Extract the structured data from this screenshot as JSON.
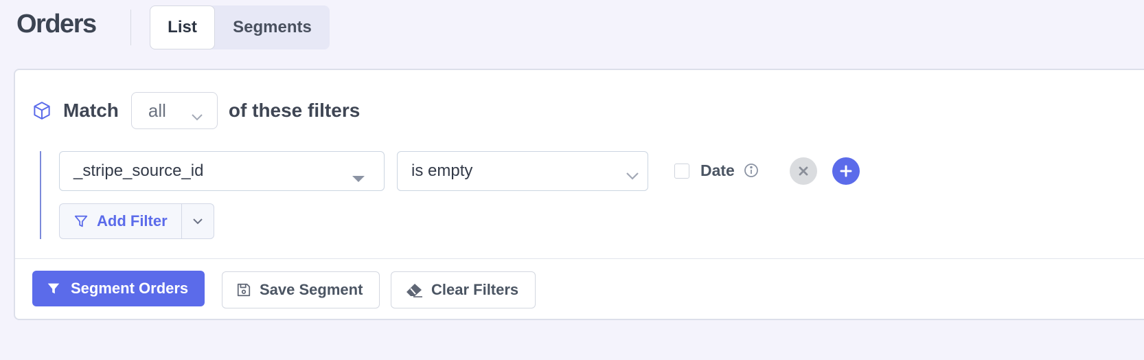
{
  "header": {
    "title": "Orders",
    "tabs": [
      {
        "label": "List",
        "active": true
      },
      {
        "label": "Segments",
        "active": false
      }
    ]
  },
  "filters": {
    "match_label": "Match",
    "match_value": "all",
    "match_suffix": "of these filters",
    "rows": [
      {
        "field": "_stripe_source_id",
        "operator": "is empty",
        "date_checked": false,
        "date_label": "Date"
      }
    ],
    "add_filter_label": "Add Filter"
  },
  "actions": {
    "segment_label": "Segment Orders",
    "save_label": "Save Segment",
    "clear_label": "Clear Filters"
  },
  "icons": {
    "match": "cube-icon",
    "add_filter": "filter-icon",
    "segment": "filter-solid-icon",
    "save": "floppy-disk-icon",
    "clear": "eraser-icon",
    "info": "info-circle-icon",
    "remove": "x-icon",
    "add": "plus-icon"
  },
  "colors": {
    "accent": "#5b6bea",
    "background": "#f4f3fc",
    "remove_button": "#dadcdf"
  }
}
